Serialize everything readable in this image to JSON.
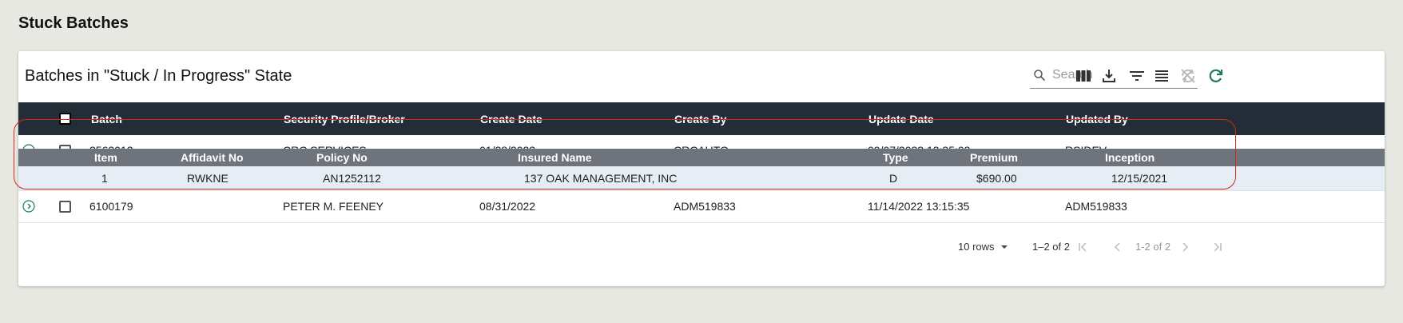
{
  "page": {
    "title": "Stuck Batches"
  },
  "card": {
    "title": "Batches in \"Stuck / In Progress\" State"
  },
  "search": {
    "placeholder": "Search",
    "value": ""
  },
  "toolbar": {
    "icons": [
      "view-columns-icon",
      "download-icon",
      "filter-icon",
      "density-icon",
      "sync-disabled-icon",
      "refresh-icon"
    ],
    "accent_color": "#1e7a5a"
  },
  "table": {
    "header_bg": "#232d37",
    "columns": [
      "Batch",
      "Security Profile/Broker",
      "Create Date",
      "Create By",
      "Update Date",
      "Updated By"
    ],
    "rows": [
      {
        "batch": "2563013",
        "broker": "CRC SERVICES",
        "create_date": "01/28/2022",
        "create_by": "CRCAUTO",
        "update_date": "09/07/2022 13:35:03",
        "updated_by": "RSIDEV",
        "expanded": true
      },
      {
        "batch": "6100179",
        "broker": "PETER M. FEENEY",
        "create_date": "08/31/2022",
        "create_by": "ADM519833",
        "update_date": "11/14/2022 13:15:35",
        "updated_by": "ADM519833",
        "expanded": false
      }
    ],
    "detail": {
      "columns": [
        "Item",
        "Affidavit No",
        "Policy No",
        "Insured Name",
        "Type",
        "Premium",
        "Inception"
      ],
      "rows": [
        {
          "item": "1",
          "affidavit_no": "RWKNE",
          "policy_no": "AN1252112",
          "insured_name": "137 OAK MANAGEMENT, INC",
          "type": "D",
          "premium": "$690.00",
          "inception": "12/15/2021"
        }
      ]
    }
  },
  "pagination": {
    "rows_per_page": "10 rows",
    "range": "1–2 of 2",
    "page_label": "1-2 of 2"
  },
  "highlight_color": "#d9231e"
}
